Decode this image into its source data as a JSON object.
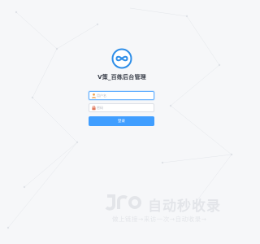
{
  "app": {
    "title": "V策_百练后台管理",
    "logo_icon": "infinity-logo-icon"
  },
  "login_form": {
    "username_placeholder": "用户名",
    "username_value": "",
    "username_icon": "user-icon",
    "password_placeholder": "密码",
    "password_value": "",
    "password_icon": "lock-icon",
    "submit_label": "登录"
  },
  "watermark": {
    "main_text": "自动秒收录",
    "sub_text": "做上链接→来访一次→自动收录→"
  },
  "colors": {
    "background": "#f6f7f9",
    "accent": "#409eff",
    "logo_blue": "#2e8ee8",
    "title_text": "#3a3f4a",
    "watermark": "#e2e4e8"
  }
}
